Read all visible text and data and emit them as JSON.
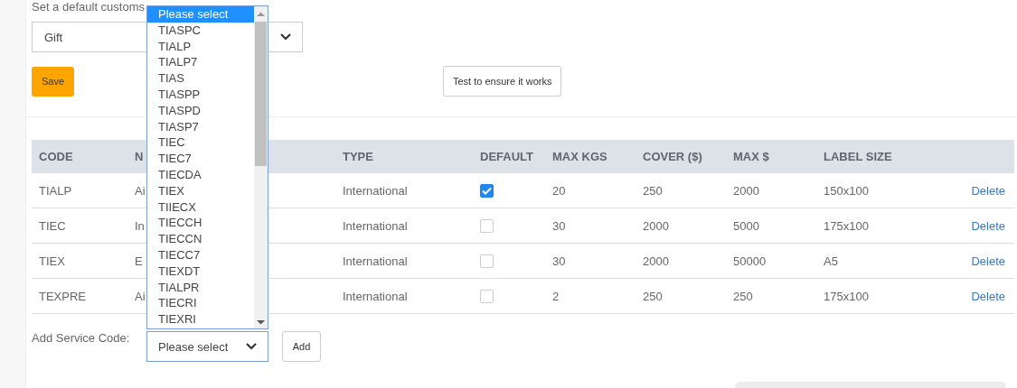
{
  "customs_default": {
    "label": "Set a default customs",
    "value": "Gift"
  },
  "buttons": {
    "save": "Save",
    "test": "Test to ensure it works"
  },
  "table": {
    "columns": [
      "CODE",
      "N",
      "TYPE",
      "DEFAULT",
      "MAX KGS",
      "COVER ($)",
      "MAX $",
      "LABEL SIZE"
    ],
    "rows": [
      {
        "code": "TIALP",
        "name": "Ai",
        "type": "International",
        "default": true,
        "max_kgs": "20",
        "cover": "250",
        "max": "2000",
        "label_size": "150x100",
        "action": "Delete"
      },
      {
        "code": "TIEC",
        "name": "In",
        "type": "International",
        "default": false,
        "max_kgs": "30",
        "cover": "2000",
        "max": "5000",
        "label_size": "175x100",
        "action": "Delete"
      },
      {
        "code": "TIEX",
        "name": "E",
        "type": "International",
        "default": false,
        "max_kgs": "30",
        "cover": "2000",
        "max": "50000",
        "label_size": "A5",
        "action": "Delete"
      },
      {
        "code": "TEXPRE",
        "name": "Ai",
        "type": "International",
        "default": false,
        "max_kgs": "2",
        "cover": "250",
        "max": "250",
        "label_size": "175x100",
        "action": "Delete"
      }
    ]
  },
  "add_service": {
    "label": "Add Service Code:",
    "value": "Please select",
    "button": "Add",
    "options": [
      {
        "label": "Please select",
        "selected": true
      },
      {
        "label": "TIASPC",
        "selected": false
      },
      {
        "label": "TIALP",
        "selected": false
      },
      {
        "label": "TIALP7",
        "selected": false
      },
      {
        "label": "TIAS",
        "selected": false
      },
      {
        "label": "TIASPP",
        "selected": false
      },
      {
        "label": "TIASPD",
        "selected": false
      },
      {
        "label": "TIASP7",
        "selected": false
      },
      {
        "label": "TIEC",
        "selected": false
      },
      {
        "label": "TIEC7",
        "selected": false
      },
      {
        "label": "TIECDA",
        "selected": false
      },
      {
        "label": "TIEX",
        "selected": false
      },
      {
        "label": "TIIECX",
        "selected": false
      },
      {
        "label": "TIECCH",
        "selected": false
      },
      {
        "label": "TIECCN",
        "selected": false
      },
      {
        "label": "TIECC7",
        "selected": false
      },
      {
        "label": "TIEXDT",
        "selected": false
      },
      {
        "label": "TIALPR",
        "selected": false
      },
      {
        "label": "TIECRI",
        "selected": false
      },
      {
        "label": "TIEXRI",
        "selected": false
      }
    ]
  }
}
